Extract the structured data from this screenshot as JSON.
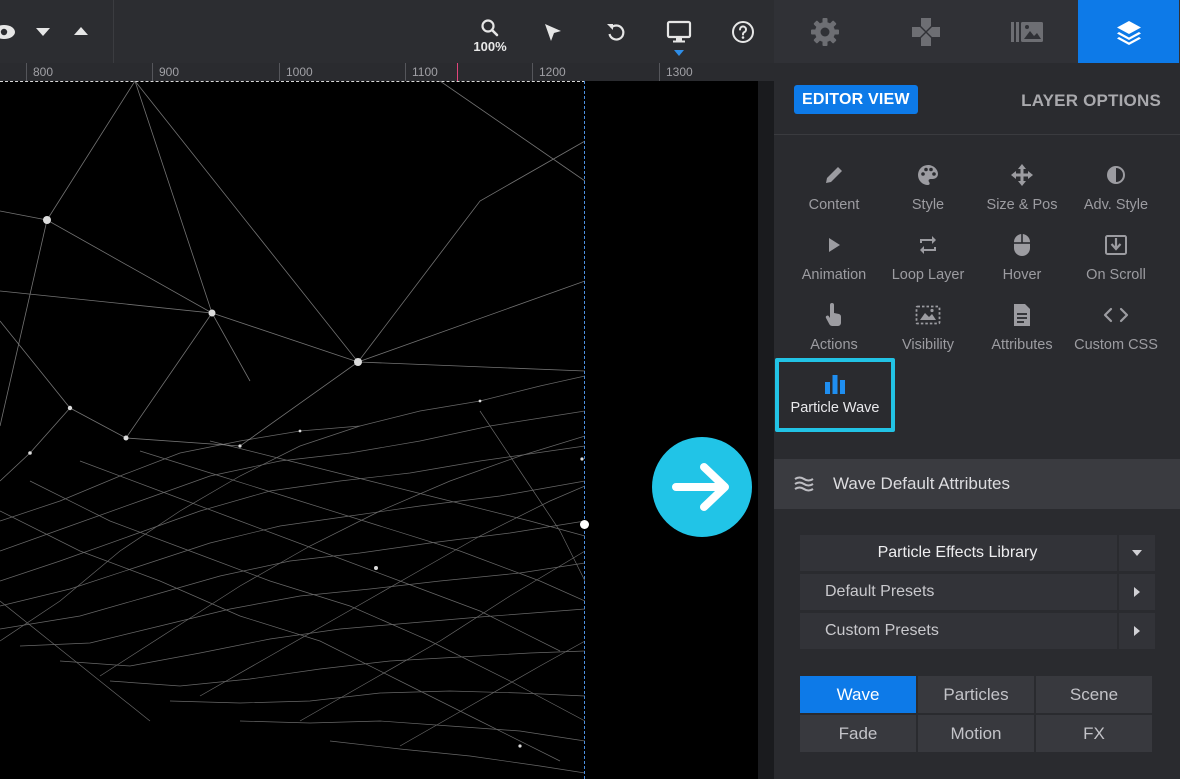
{
  "toolbar": {
    "zoom_label": "100%",
    "icons": [
      "eye-icon",
      "chevron-down-icon",
      "chevron-up-icon",
      "zoom-icon",
      "pointer-icon",
      "undo-icon",
      "desktop-icon",
      "help-icon"
    ]
  },
  "ruler": {
    "labels": [
      "800",
      "900",
      "1000",
      "1100",
      "1200",
      "1300"
    ]
  },
  "panel": {
    "tabs": [
      "gear-icon",
      "gamepad-icon",
      "library-icon",
      "layers-icon"
    ],
    "view": {
      "editor_view": "EDITOR VIEW",
      "layer_options": "LAYER OPTIONS"
    },
    "options": [
      {
        "label": "Content",
        "icon": "pencil-icon"
      },
      {
        "label": "Style",
        "icon": "palette-icon"
      },
      {
        "label": "Size & Pos",
        "icon": "move-icon"
      },
      {
        "label": "Adv. Style",
        "icon": "contrast-icon"
      },
      {
        "label": "Animation",
        "icon": "play-icon"
      },
      {
        "label": "Loop Layer",
        "icon": "loop-icon"
      },
      {
        "label": "Hover",
        "icon": "mouse-icon"
      },
      {
        "label": "On Scroll",
        "icon": "scroll-download-icon"
      },
      {
        "label": "Actions",
        "icon": "hand-pointer-icon"
      },
      {
        "label": "Visibility",
        "icon": "visibility-icon"
      },
      {
        "label": "Attributes",
        "icon": "document-icon"
      },
      {
        "label": "Custom CSS",
        "icon": "code-icon"
      },
      {
        "label": "Particle Wave",
        "icon": "bar-chart-icon"
      }
    ],
    "section_title": "Wave Default Attributes",
    "library": {
      "title": "Particle Effects Library",
      "default_presets": "Default Presets",
      "custom_presets": "Custom Presets"
    },
    "segments": [
      "Wave",
      "Particles",
      "Scene",
      "Fade",
      "Motion",
      "FX"
    ],
    "active_segment": "Wave"
  },
  "colors": {
    "accent": "#0d7ae8",
    "cyan": "#22c3e5",
    "panel": "#2a2b2f"
  }
}
